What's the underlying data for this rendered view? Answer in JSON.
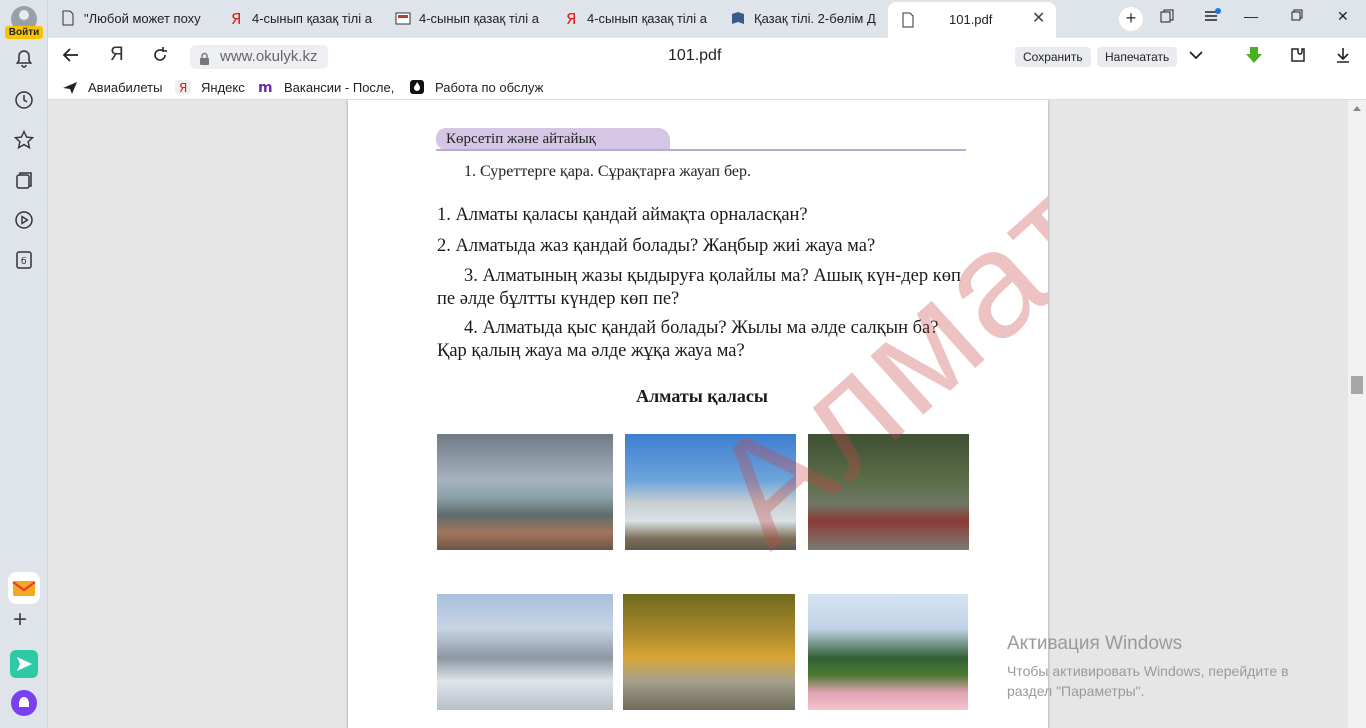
{
  "rail": {
    "login_label": "Войти"
  },
  "tabs": [
    {
      "label": "\"Любой может поху"
    },
    {
      "label": "4-сынып қазақ тілі а"
    },
    {
      "label": "4-сынып қазақ тілі а"
    },
    {
      "label": "4-сынып қазақ тілі а"
    },
    {
      "label": "Қазақ тілі. 2-бөлім Д"
    },
    {
      "label": "101.pdf"
    }
  ],
  "toolbar": {
    "url": "www.okulyk.kz",
    "doc_title": "101.pdf",
    "save_label": "Сохранить",
    "print_label": "Напечатать"
  },
  "bookmarks": [
    {
      "label": "Авиабилеты"
    },
    {
      "label": "Яндекс"
    },
    {
      "label": "Вакансии - После,"
    },
    {
      "label": "Работа по обслуж"
    }
  ],
  "page": {
    "section_title": "Көрсетіп және айтайық",
    "task": "1. Суреттерге қара. Сұрақтарға жауап бер.",
    "questions": [
      "1. Алматы қаласы қандай аймақта орналасқан?",
      "2. Алматыда жаз қандай болады? Жаңбыр жиі жауа ма?",
      "3. Алматының жазы қыдыруға қолайлы ма? Ашық күн-дер көп пе әлде бұлтты күндер көп пе?",
      "4. Алматыда қыс қандай болады? Жылы ма әлде салқын ба? Қар қалың жауа ма әлде жұқа жауа ма?"
    ],
    "caption": "Алматы қаласы",
    "watermark": "Алматыкітап"
  },
  "activation": {
    "title": "Активация Windows",
    "text": "Чтобы активировать Windows, перейдите в раздел \"Параметры\"."
  },
  "colors": {
    "accent_lilac": "#d4c6e4",
    "watermark": "#c84646",
    "login_badge": "#f7c400"
  }
}
